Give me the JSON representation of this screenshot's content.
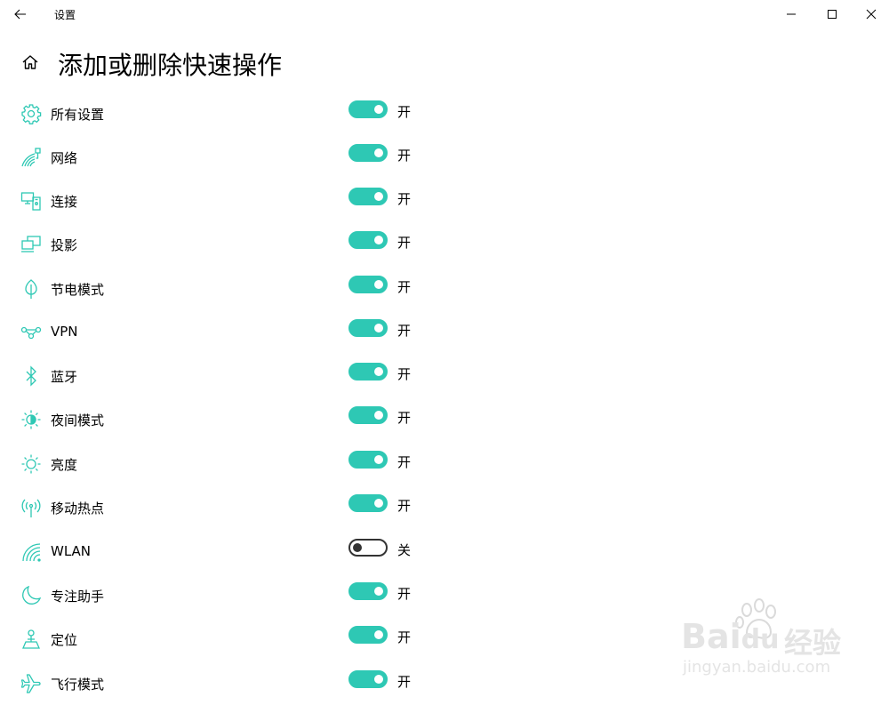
{
  "window": {
    "title": "设置",
    "back_icon": "arrow-left-icon",
    "minimize_icon": "minimize-icon",
    "maximize_icon": "maximize-icon",
    "close_icon": "close-icon"
  },
  "header": {
    "home_icon": "home-icon",
    "title": "添加或删除快速操作"
  },
  "accent_color": "#2ec8b4",
  "items": [
    {
      "label": "所有设置",
      "icon": "gear-icon",
      "on": true,
      "state": "开"
    },
    {
      "label": "网络",
      "icon": "network-icon",
      "on": true,
      "state": "开"
    },
    {
      "label": "连接",
      "icon": "connect-icon",
      "on": true,
      "state": "开"
    },
    {
      "label": "投影",
      "icon": "project-icon",
      "on": true,
      "state": "开"
    },
    {
      "label": "节电模式",
      "icon": "battery-saver-icon",
      "on": true,
      "state": "开"
    },
    {
      "label": "VPN",
      "icon": "vpn-icon",
      "on": true,
      "state": "开"
    },
    {
      "label": "蓝牙",
      "icon": "bluetooth-icon",
      "on": true,
      "state": "开"
    },
    {
      "label": "夜间模式",
      "icon": "night-light-icon",
      "on": true,
      "state": "开"
    },
    {
      "label": "亮度",
      "icon": "brightness-icon",
      "on": true,
      "state": "开"
    },
    {
      "label": "移动热点",
      "icon": "hotspot-icon",
      "on": true,
      "state": "开"
    },
    {
      "label": "WLAN",
      "icon": "wifi-icon",
      "on": false,
      "state": "关"
    },
    {
      "label": "专注助手",
      "icon": "moon-icon",
      "on": true,
      "state": "开"
    },
    {
      "label": "定位",
      "icon": "location-icon",
      "on": true,
      "state": "开"
    },
    {
      "label": "飞行模式",
      "icon": "airplane-icon",
      "on": true,
      "state": "开"
    }
  ],
  "watermark": {
    "logo": "Bai",
    "logo_du": "du",
    "suffix": "经验",
    "url": "jingyan.baidu.com"
  }
}
